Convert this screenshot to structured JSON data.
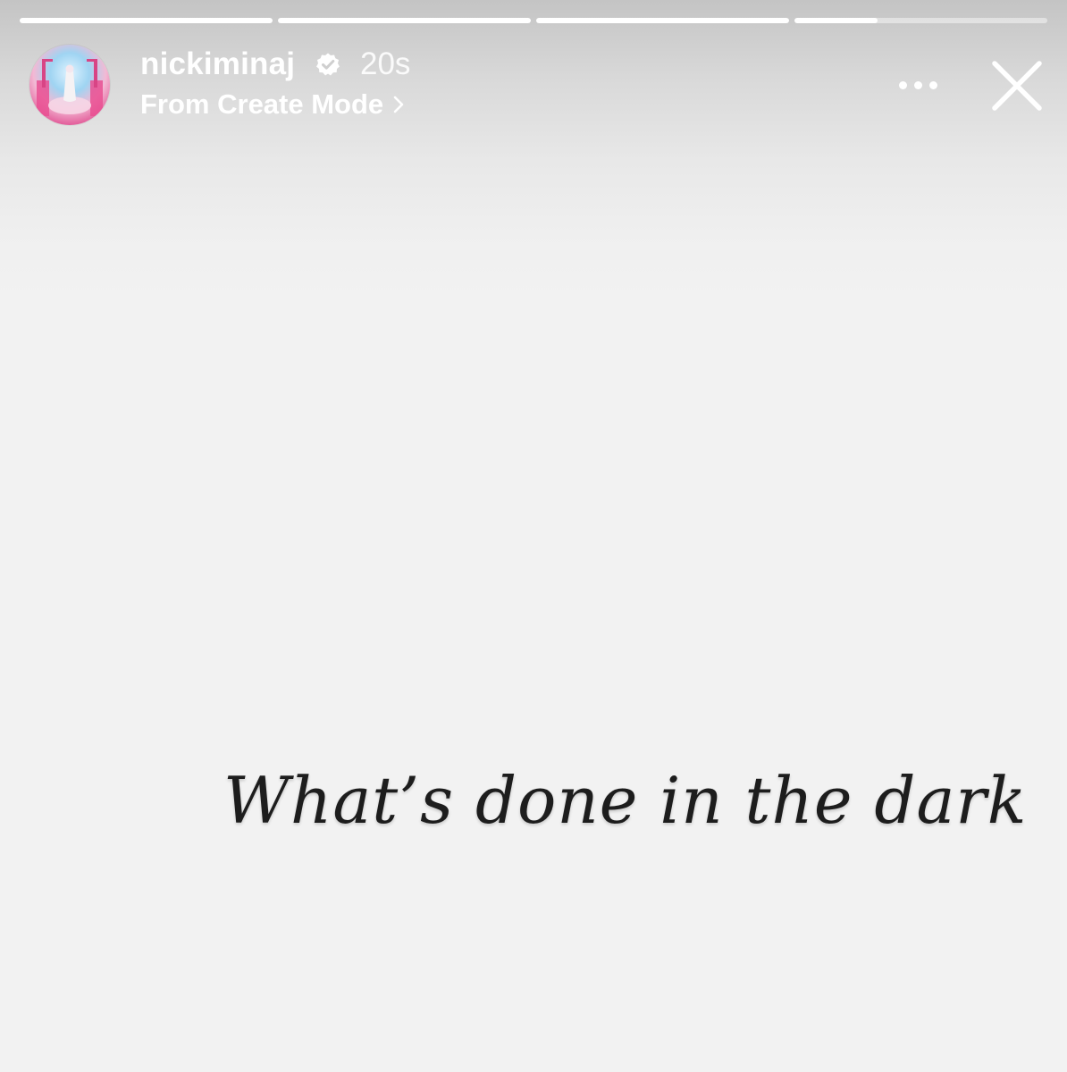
{
  "story": {
    "progress": [
      1,
      1,
      1,
      0.33
    ],
    "background_color": "#f2f2f2",
    "text": "What’s done in the dark",
    "text_color": "#1d1d1d"
  },
  "header": {
    "username": "nickiminaj",
    "verified": true,
    "timestamp": "20s",
    "subtitle": "From Create Mode",
    "icons": [
      "verified-badge-icon",
      "chevron-right-icon",
      "more-icon",
      "close-icon"
    ]
  },
  "colors": {
    "header_text": "#ffffff",
    "avatar_accent": "#e25a98"
  }
}
